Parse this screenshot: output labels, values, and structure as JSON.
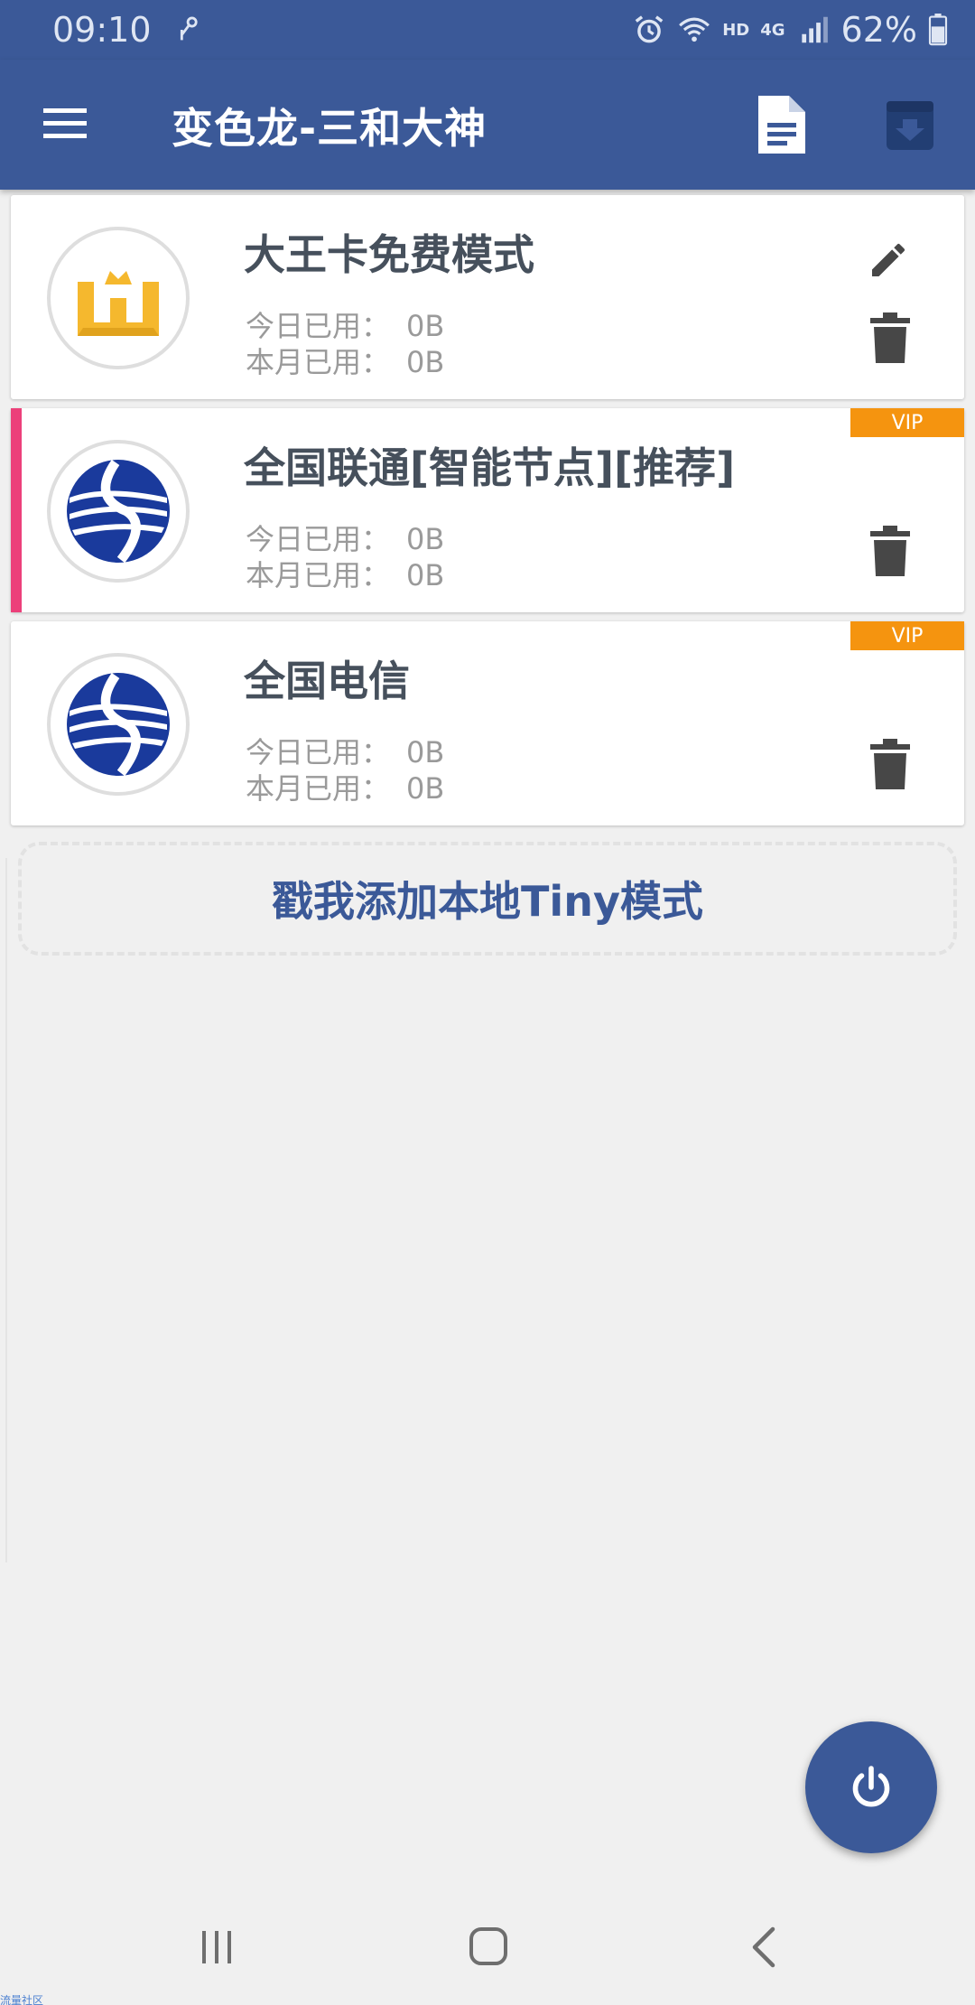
{
  "status_bar": {
    "time": "09:10",
    "hd_label": "HD",
    "network_label": "4G",
    "battery_percent": "62%"
  },
  "app_bar": {
    "title": "变色龙-三和大神",
    "icons": [
      "menu-icon",
      "document-icon",
      "archive-download-icon"
    ]
  },
  "modes": [
    {
      "title": "大王卡免费模式",
      "today_label": "今日已用：",
      "today_value": "0B",
      "month_label": "本月已用：",
      "month_value": "0B",
      "vip": "",
      "selected": false
    },
    {
      "title": "全国联通[智能节点][推荐]",
      "today_label": "今日已用：",
      "today_value": "0B",
      "month_label": "本月已用：",
      "month_value": "0B",
      "vip": "VIP",
      "selected": true
    },
    {
      "title": "全国电信",
      "today_label": "今日已用：",
      "today_value": "0B",
      "month_label": "本月已用：",
      "month_value": "0B",
      "vip": "VIP",
      "selected": false
    }
  ],
  "add_local": {
    "label": "戳我添加本地Tiny模式"
  },
  "watermark": "流量社区",
  "colors": {
    "primary": "#3b5998",
    "accent_selected": "#ec407a",
    "vip": "#f5940f",
    "logo_gold": "#f5b82e",
    "logo_blue": "#1a3a9c"
  }
}
